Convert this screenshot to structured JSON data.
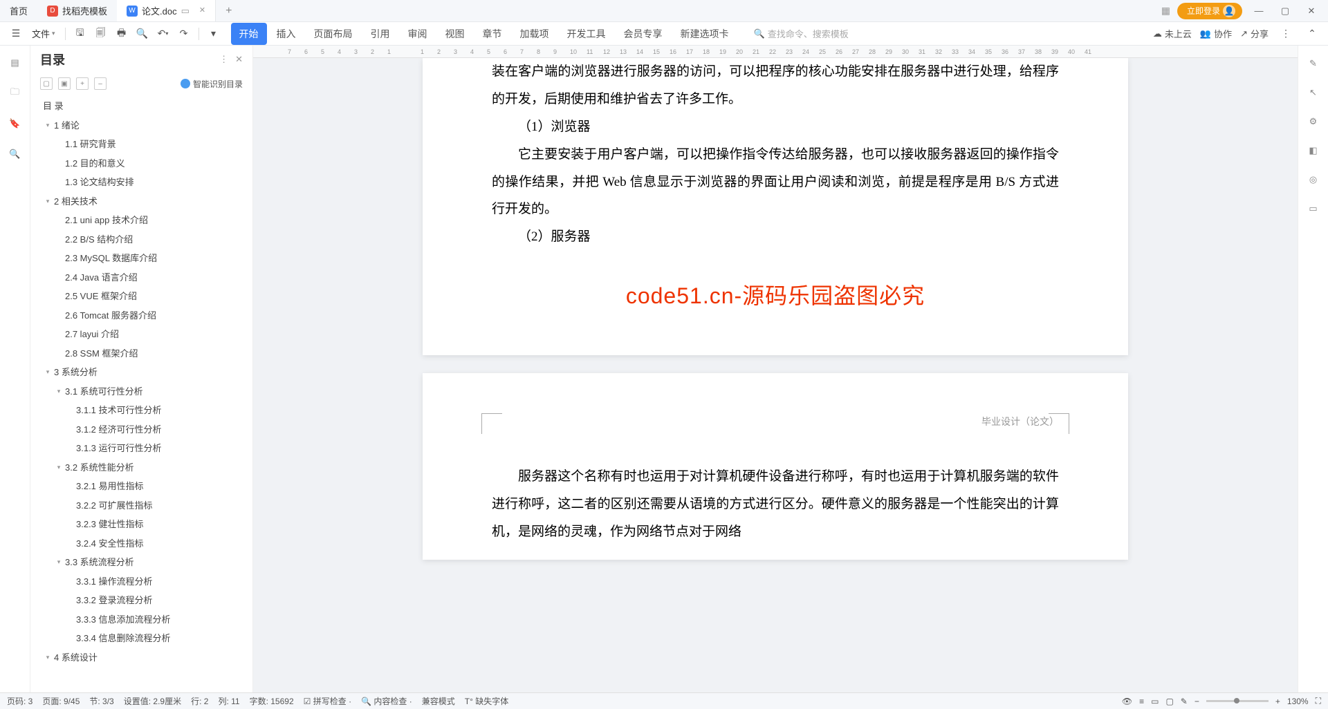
{
  "titlebar": {
    "home": "首页",
    "template_tab": "找稻壳模板",
    "doc_tab": "论文.doc",
    "login": "立即登录"
  },
  "toolbar": {
    "file": "文件"
  },
  "ribbon": {
    "tabs": [
      "开始",
      "插入",
      "页面布局",
      "引用",
      "审阅",
      "视图",
      "章节",
      "加载项",
      "开发工具",
      "会员专享",
      "新建选项卡"
    ],
    "search_placeholder": "查找命令、搜索模板",
    "cloud": "未上云",
    "collab": "协作",
    "share": "分享"
  },
  "toc": {
    "title": "目录",
    "smart": "智能识别目录",
    "root": "目 录",
    "items": [
      {
        "d": 1,
        "c": true,
        "t": "1 绪论"
      },
      {
        "d": 2,
        "c": false,
        "t": "1.1 研究背景"
      },
      {
        "d": 2,
        "c": false,
        "t": "1.2 目的和意义"
      },
      {
        "d": 2,
        "c": false,
        "t": "1.3 论文结构安排"
      },
      {
        "d": 1,
        "c": true,
        "t": "2 相关技术"
      },
      {
        "d": 2,
        "c": false,
        "t": "2.1 uni app 技术介绍"
      },
      {
        "d": 2,
        "c": false,
        "t": "2.2 B/S 结构介绍"
      },
      {
        "d": 2,
        "c": false,
        "t": "2.3 MySQL 数据库介绍"
      },
      {
        "d": 2,
        "c": false,
        "t": "2.4 Java 语言介绍"
      },
      {
        "d": 2,
        "c": false,
        "t": "2.5 VUE 框架介绍"
      },
      {
        "d": 2,
        "c": false,
        "t": "2.6 Tomcat 服务器介绍"
      },
      {
        "d": 2,
        "c": false,
        "t": "2.7 layui 介绍"
      },
      {
        "d": 2,
        "c": false,
        "t": "2.8 SSM 框架介绍"
      },
      {
        "d": 1,
        "c": true,
        "t": "3 系统分析"
      },
      {
        "d": 2,
        "c": true,
        "t": "3.1 系统可行性分析"
      },
      {
        "d": 3,
        "c": false,
        "t": "3.1.1 技术可行性分析"
      },
      {
        "d": 3,
        "c": false,
        "t": "3.1.2 经济可行性分析"
      },
      {
        "d": 3,
        "c": false,
        "t": "3.1.3 运行可行性分析"
      },
      {
        "d": 2,
        "c": true,
        "t": "3.2 系统性能分析"
      },
      {
        "d": 3,
        "c": false,
        "t": "3.2.1 易用性指标"
      },
      {
        "d": 3,
        "c": false,
        "t": "3.2.2 可扩展性指标"
      },
      {
        "d": 3,
        "c": false,
        "t": "3.2.3 健壮性指标"
      },
      {
        "d": 3,
        "c": false,
        "t": "3.2.4 安全性指标"
      },
      {
        "d": 2,
        "c": true,
        "t": "3.3 系统流程分析"
      },
      {
        "d": 3,
        "c": false,
        "t": "3.3.1 操作流程分析"
      },
      {
        "d": 3,
        "c": false,
        "t": "3.3.2 登录流程分析"
      },
      {
        "d": 3,
        "c": false,
        "t": "3.3.3 信息添加流程分析"
      },
      {
        "d": 3,
        "c": false,
        "t": "3.3.4 信息删除流程分析"
      },
      {
        "d": 1,
        "c": true,
        "t": "4 系统设计"
      }
    ]
  },
  "document": {
    "page1": {
      "para1": "装在客户端的浏览器进行服务器的访问，可以把程序的核心功能安排在服务器中进行处理，给程序的开发，后期使用和维护省去了许多工作。",
      "sub1": "（1）浏览器",
      "para2": "它主要安装于用户客户端，可以把操作指令传达给服务器，也可以接收服务器返回的操作指令的操作结果，并把 Web 信息显示于浏览器的界面让用户阅读和浏览，前提是程序是用 B/S 方式进行开发的。",
      "sub2": "（2）服务器",
      "watermark": "code51.cn-源码乐园盗图必究"
    },
    "page2": {
      "header": "毕业设计（论文）",
      "para1": "服务器这个名称有时也运用于对计算机硬件设备进行称呼，有时也运用于计算机服务端的软件进行称呼，这二者的区别还需要从语境的方式进行区分。硬件意义的服务器是一个性能突出的计算机，是网络的灵魂，作为网络节点对于网络"
    }
  },
  "status": {
    "pg": "页码: 3",
    "pages": "页面: 9/45",
    "sec": "节: 3/3",
    "setval": "设置值: 2.9厘米",
    "row": "行: 2",
    "col": "列: 11",
    "words": "字数: 15692",
    "spell": "拼写检查",
    "content": "内容检查",
    "compat": "兼容模式",
    "font": "缺失字体",
    "zoom": "130%"
  },
  "ruler": [
    "7",
    "6",
    "5",
    "4",
    "3",
    "2",
    "1",
    "",
    "1",
    "2",
    "3",
    "4",
    "5",
    "6",
    "7",
    "8",
    "9",
    "10",
    "11",
    "12",
    "13",
    "14",
    "15",
    "16",
    "17",
    "18",
    "19",
    "20",
    "21",
    "22",
    "23",
    "24",
    "25",
    "26",
    "27",
    "28",
    "29",
    "30",
    "31",
    "32",
    "33",
    "34",
    "35",
    "36",
    "37",
    "38",
    "39",
    "40",
    "41"
  ]
}
